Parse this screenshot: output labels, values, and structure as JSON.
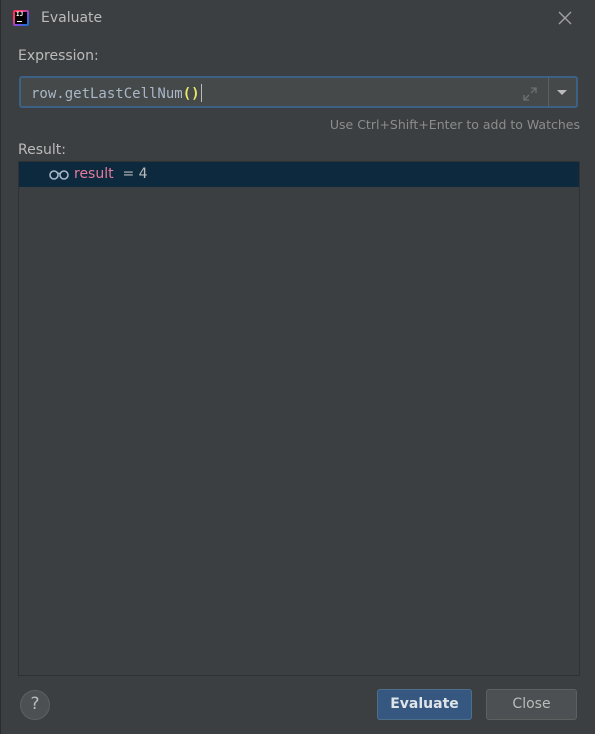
{
  "window": {
    "title": "Evaluate"
  },
  "expression": {
    "label": "Expression:",
    "value_main": "row.getLastCellNum",
    "value_parens": "()",
    "hint": "Use Ctrl+Shift+Enter to add to Watches"
  },
  "result": {
    "label": "Result:",
    "name": "result",
    "equals_value": " = 4"
  },
  "buttons": {
    "help": "?",
    "evaluate": "Evaluate",
    "close": "Close"
  },
  "icons": {
    "app": "intellij-idea-icon",
    "close": "close-icon",
    "expand": "expand-icon",
    "dropdown": "chevron-down-icon",
    "watch": "glasses-icon"
  },
  "colors": {
    "background": "#3c3f41",
    "input_focus_border": "#3d6185",
    "selected_row": "#0d293e",
    "variable_name": "#e77a9d",
    "paren_highlight": "#e8e864",
    "primary_button": "#365880"
  }
}
